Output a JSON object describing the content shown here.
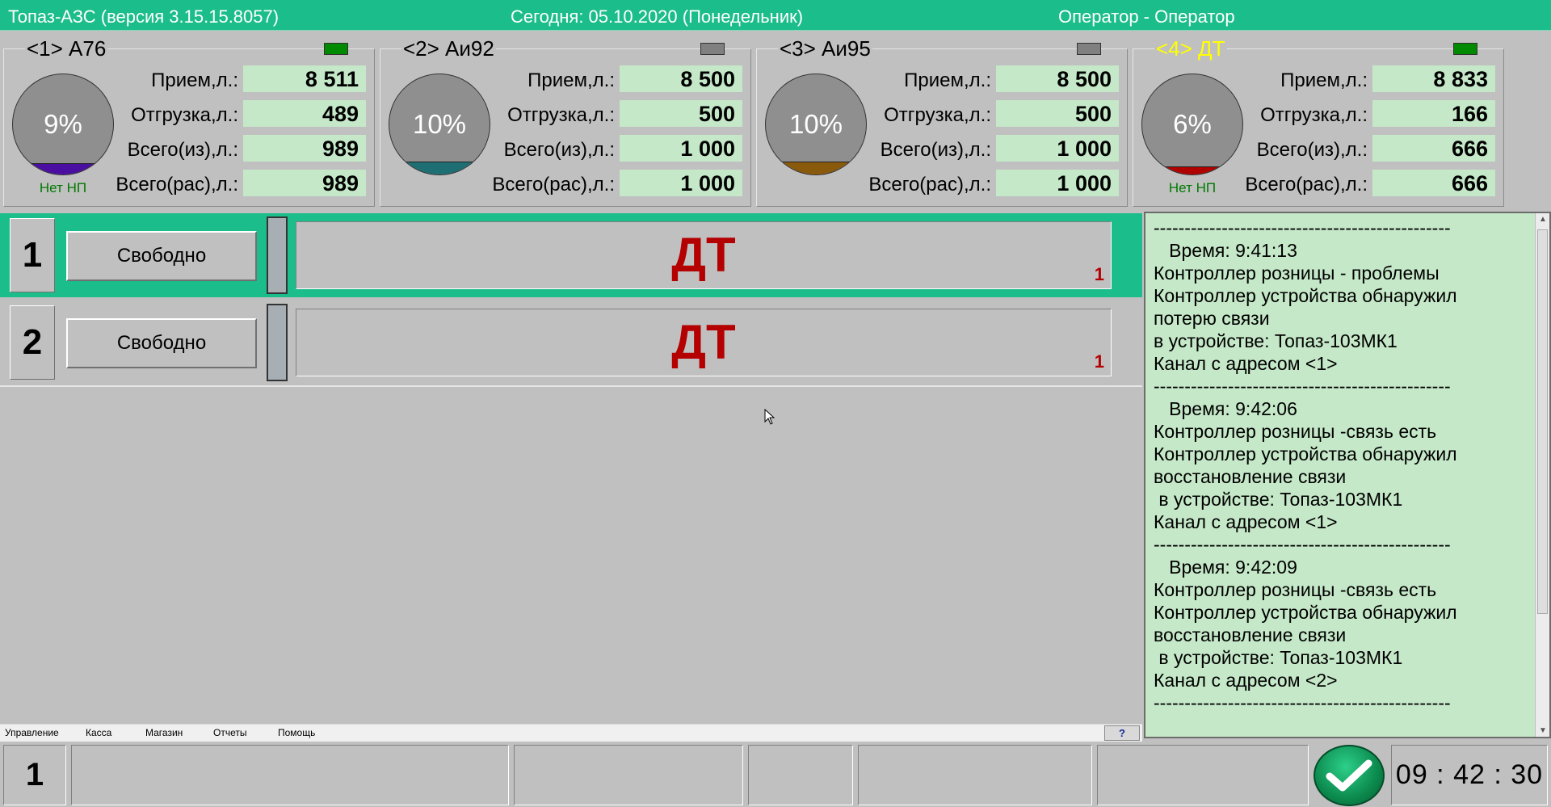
{
  "window": {
    "app_title": "Топаз-АЗС  (версия 3.15.15.8057)",
    "today": "Сегодня: 05.10.2020  (Понедельник)",
    "operator": "Оператор - Оператор"
  },
  "tanks": [
    {
      "title": "<1> А76",
      "title_color": "#000000",
      "led_color": "#008a00",
      "level_percent": 9,
      "percent_label": "9%",
      "fill_color": "#4a0fa0",
      "note": "Нет НП",
      "rows": [
        {
          "label": "Прием,л.:",
          "value": "8 511"
        },
        {
          "label": "Отгрузка,л.:",
          "value": "489"
        },
        {
          "label": "Всего(из),л.:",
          "value": "989"
        },
        {
          "label": "Всего(рас),л.:",
          "value": "989"
        }
      ]
    },
    {
      "title": "<2> Аи92",
      "title_color": "#000000",
      "led_color": "#808080",
      "level_percent": 10,
      "percent_label": "10%",
      "fill_color": "#1e6f73",
      "note": "",
      "rows": [
        {
          "label": "Прием,л.:",
          "value": "8 500"
        },
        {
          "label": "Отгрузка,л.:",
          "value": "500"
        },
        {
          "label": "Всего(из),л.:",
          "value": "1 000"
        },
        {
          "label": "Всего(рас),л.:",
          "value": "1 000"
        }
      ]
    },
    {
      "title": "<3> Аи95",
      "title_color": "#000000",
      "led_color": "#808080",
      "level_percent": 10,
      "percent_label": "10%",
      "fill_color": "#8a5a0c",
      "note": "",
      "rows": [
        {
          "label": "Прием,л.:",
          "value": "8 500"
        },
        {
          "label": "Отгрузка,л.:",
          "value": "500"
        },
        {
          "label": "Всего(из),л.:",
          "value": "1 000"
        },
        {
          "label": "Всего(рас),л.:",
          "value": "1 000"
        }
      ]
    },
    {
      "title": "<4> ДТ",
      "title_color": "#ffff00",
      "led_color": "#008a00",
      "level_percent": 6,
      "percent_label": "6%",
      "fill_color": "#b00000",
      "note": "Нет НП",
      "rows": [
        {
          "label": "Прием,л.:",
          "value": "8 833"
        },
        {
          "label": "Отгрузка,л.:",
          "value": "166"
        },
        {
          "label": "Всего(из),л.:",
          "value": "666"
        },
        {
          "label": "Всего(рас),л.:",
          "value": "666"
        }
      ]
    }
  ],
  "pumps": [
    {
      "number": "1",
      "status": "Свободно",
      "fuel": "ДТ",
      "nozzle": "1",
      "selected": true
    },
    {
      "number": "2",
      "status": "Свободно",
      "fuel": "ДТ",
      "nozzle": "1",
      "selected": false
    }
  ],
  "log": {
    "lines": [
      "------------------------------------------------",
      "   Время: 9:41:13",
      "Контроллер розницы - проблемы",
      "Контроллер устройства обнаружил",
      "потерю связи",
      "в устройстве: Топаз-103МК1",
      "Канал с адресом <1>",
      "------------------------------------------------",
      "   Время: 9:42:06",
      "Контроллер розницы -связь есть",
      "Контроллер устройства обнаружил",
      "восстановление связи",
      " в устройстве: Топаз-103МК1",
      "Канал с адресом <1>",
      "------------------------------------------------",
      "   Время: 9:42:09",
      "Контроллер розницы -связь есть",
      "Контроллер устройства обнаружил",
      "восстановление связи",
      " в устройстве: Топаз-103МК1",
      "Канал с адресом <2>",
      "------------------------------------------------"
    ]
  },
  "menu": {
    "items": [
      "Управление",
      "Касса",
      "Магазин",
      "Отчеты",
      "Помощь"
    ],
    "help_label": "?"
  },
  "bottom": {
    "number": "1",
    "clock": "09 : 42 : 30"
  },
  "icons": {
    "ok": "checkmark-icon",
    "cursor": "mouse-cursor-icon"
  }
}
